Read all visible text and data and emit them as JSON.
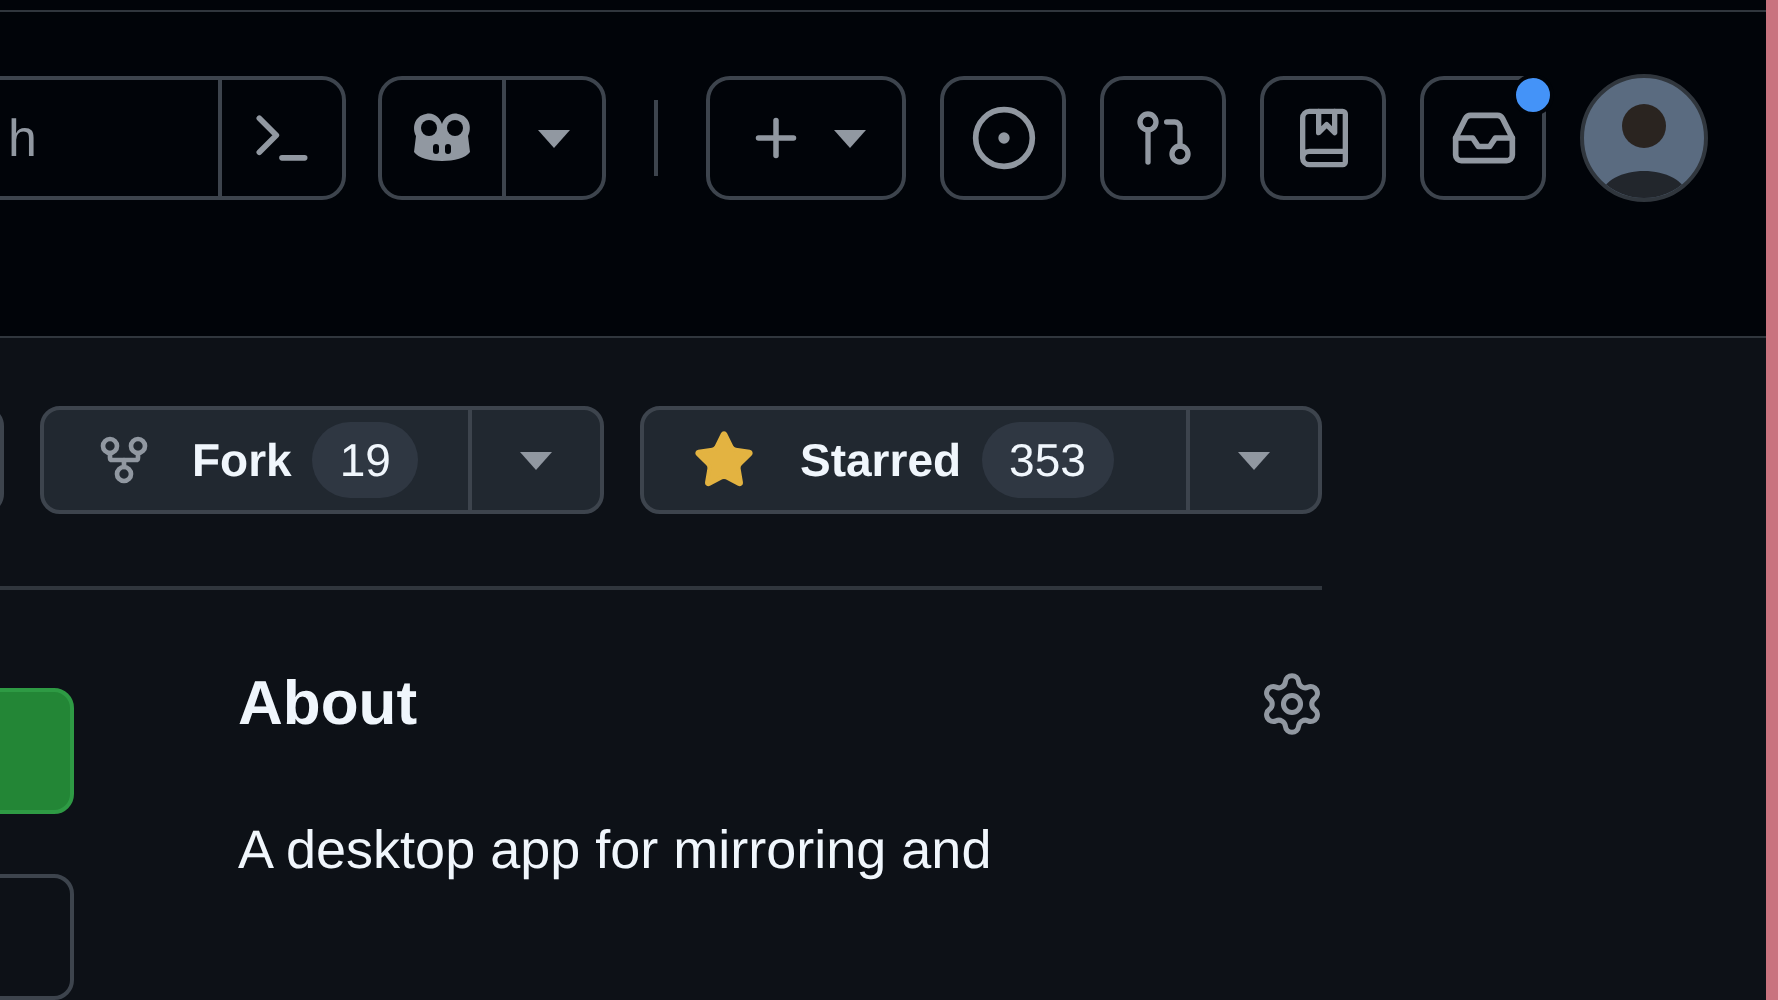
{
  "header": {
    "search": {
      "placeholder": "h"
    },
    "notifications": {
      "unread": true
    }
  },
  "repo_actions": {
    "fork": {
      "label": "Fork",
      "count": "19"
    },
    "star": {
      "label": "Starred",
      "count": "353",
      "starred": true
    }
  },
  "about": {
    "title": "About",
    "description": "A desktop app for mirroring and"
  }
}
